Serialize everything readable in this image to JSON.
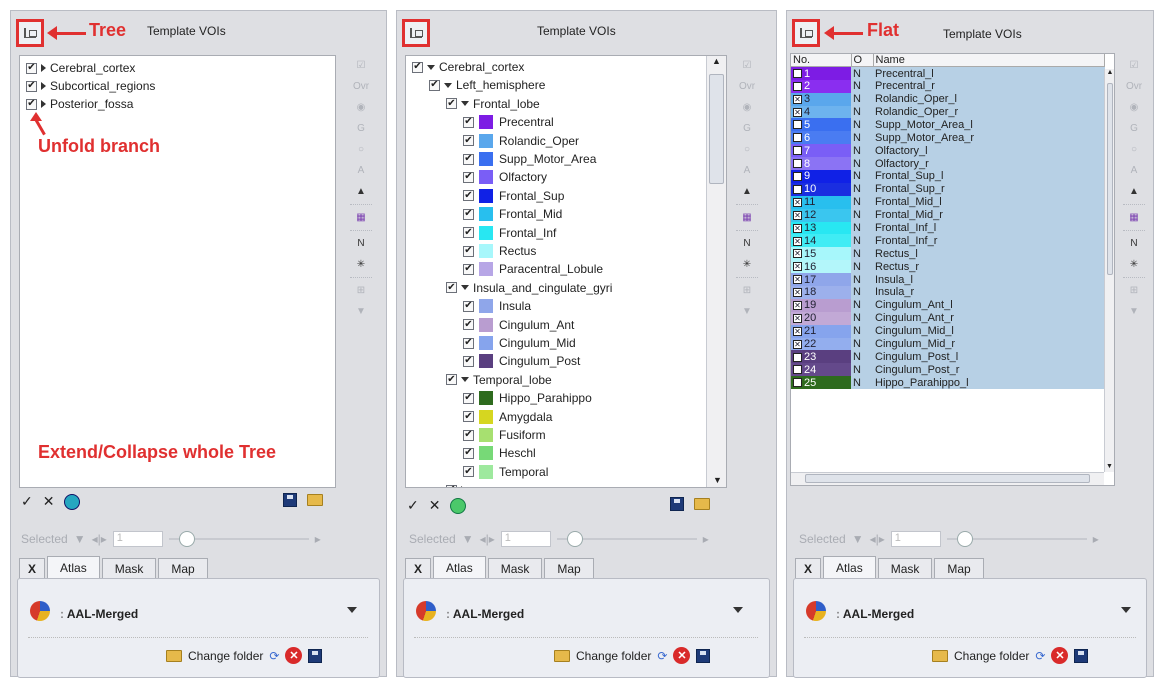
{
  "panels": [
    {
      "title": "Template VOIs",
      "annotation": "Tree",
      "tree": [
        {
          "label": "Cerebral_cortex",
          "checked": true
        },
        {
          "label": "Subcortical_regions",
          "checked": true
        },
        {
          "label": "Posterior_fossa",
          "checked": true
        }
      ],
      "note_unfold": "Unfold branch",
      "note_extend": "Extend/Collapse whole Tree"
    },
    {
      "title": "Template VOIs",
      "tree": {
        "root": "Cerebral_cortex",
        "hemisphere": "Left_hemisphere",
        "groups": [
          {
            "label": "Frontal_lobe",
            "items": [
              {
                "label": "Precentral",
                "color": "#7d1ce4"
              },
              {
                "label": "Rolandic_Oper",
                "color": "#5aa7ec"
              },
              {
                "label": "Supp_Motor_Area",
                "color": "#3a6ff0"
              },
              {
                "label": "Olfactory",
                "color": "#7a5ef6"
              },
              {
                "label": "Frontal_Sup",
                "color": "#1021e6"
              },
              {
                "label": "Frontal_Mid",
                "color": "#28bfee"
              },
              {
                "label": "Frontal_Inf",
                "color": "#28e7f2"
              },
              {
                "label": "Rectus",
                "color": "#a7f7fb"
              },
              {
                "label": "Paracentral_Lobule",
                "color": "#b7a6e6"
              }
            ]
          },
          {
            "label": "Insula_and_cingulate_gyri",
            "items": [
              {
                "label": "Insula",
                "color": "#8fa6ea"
              },
              {
                "label": "Cingulum_Ant",
                "color": "#b99dd0"
              },
              {
                "label": "Cingulum_Mid",
                "color": "#86a4ed"
              },
              {
                "label": "Cingulum_Post",
                "color": "#5a3f80"
              }
            ]
          },
          {
            "label": "Temporal_lobe",
            "items": [
              {
                "label": "Hippo_Parahippo",
                "color": "#2e6b1e"
              },
              {
                "label": "Amygdala",
                "color": "#d6d620"
              },
              {
                "label": "Fusiform",
                "color": "#a7e070"
              },
              {
                "label": "Heschl",
                "color": "#77d977"
              },
              {
                "label": "Temporal",
                "color": "#9ee99e"
              }
            ]
          }
        ]
      }
    },
    {
      "title": "Template VOIs",
      "annotation": "Flat",
      "headers": [
        "No.",
        "O",
        "Name"
      ],
      "rows": [
        {
          "no": "1",
          "o": "N",
          "name": "Precentral_l",
          "color": "#7d1ce4"
        },
        {
          "no": "2",
          "o": "N",
          "name": "Precentral_r",
          "color": "#8a2ef0"
        },
        {
          "no": "3",
          "o": "N",
          "name": "Rolandic_Oper_l",
          "color": "#5aa7ec"
        },
        {
          "no": "4",
          "o": "N",
          "name": "Rolandic_Oper_r",
          "color": "#6db3ee"
        },
        {
          "no": "5",
          "o": "N",
          "name": "Supp_Motor_Area_l",
          "color": "#3a6ff0"
        },
        {
          "no": "6",
          "o": "N",
          "name": "Supp_Motor_Area_r",
          "color": "#4a7cf2"
        },
        {
          "no": "7",
          "o": "N",
          "name": "Olfactory_l",
          "color": "#7a5ef6"
        },
        {
          "no": "8",
          "o": "N",
          "name": "Olfactory_r",
          "color": "#8b73f4"
        },
        {
          "no": "9",
          "o": "N",
          "name": "Frontal_Sup_l",
          "color": "#1021e6"
        },
        {
          "no": "10",
          "o": "N",
          "name": "Frontal_Sup_r",
          "color": "#1a2ee0"
        },
        {
          "no": "11",
          "o": "N",
          "name": "Frontal_Mid_l",
          "color": "#28bfee"
        },
        {
          "no": "12",
          "o": "N",
          "name": "Frontal_Mid_r",
          "color": "#3ac6ef"
        },
        {
          "no": "13",
          "o": "N",
          "name": "Frontal_Inf_l",
          "color": "#28e7f2"
        },
        {
          "no": "14",
          "o": "N",
          "name": "Frontal_Inf_r",
          "color": "#40ecf4"
        },
        {
          "no": "15",
          "o": "N",
          "name": "Rectus_l",
          "color": "#a7f7fb"
        },
        {
          "no": "16",
          "o": "N",
          "name": "Rectus_r",
          "color": "#b3f6fa"
        },
        {
          "no": "17",
          "o": "N",
          "name": "Insula_l",
          "color": "#8fa6ea"
        },
        {
          "no": "18",
          "o": "N",
          "name": "Insula_r",
          "color": "#9cb0ec"
        },
        {
          "no": "19",
          "o": "N",
          "name": "Cingulum_Ant_l",
          "color": "#b99dd0"
        },
        {
          "no": "20",
          "o": "N",
          "name": "Cingulum_Ant_r",
          "color": "#c2a9d6"
        },
        {
          "no": "21",
          "o": "N",
          "name": "Cingulum_Mid_l",
          "color": "#86a4ed"
        },
        {
          "no": "22",
          "o": "N",
          "name": "Cingulum_Mid_r",
          "color": "#93aeee"
        },
        {
          "no": "23",
          "o": "N",
          "name": "Cingulum_Post_l",
          "color": "#5a3f80"
        },
        {
          "no": "24",
          "o": "N",
          "name": "Cingulum_Post_r",
          "color": "#64498b"
        },
        {
          "no": "25",
          "o": "N",
          "name": "Hippo_Parahippo_l",
          "color": "#2e6b1e"
        }
      ]
    }
  ],
  "side_tools": [
    "Ovr",
    "G",
    "A",
    "N"
  ],
  "selected_label": "Selected",
  "selected_value": "1",
  "tabs": [
    "X",
    "Atlas",
    "Mask",
    "Map"
  ],
  "atlas_name": "AAL-Merged",
  "change_folder": "Change folder"
}
